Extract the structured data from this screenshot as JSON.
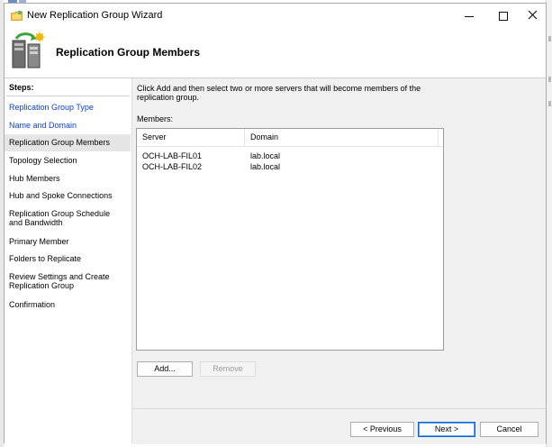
{
  "window": {
    "title": "New Replication Group Wizard",
    "header_title": "Replication Group Members"
  },
  "steps": {
    "title": "Steps:",
    "items": [
      {
        "label": "Replication Group Type",
        "state": "link"
      },
      {
        "label": "Name and Domain",
        "state": "link"
      },
      {
        "label": "Replication Group Members",
        "state": "current"
      },
      {
        "label": "Topology Selection",
        "state": "pending"
      },
      {
        "label": "Hub Members",
        "state": "pending"
      },
      {
        "label": "Hub and Spoke Connections",
        "state": "pending"
      },
      {
        "label": "Replication Group Schedule and Bandwidth",
        "state": "pending"
      },
      {
        "label": "Primary Member",
        "state": "pending"
      },
      {
        "label": "Folders to Replicate",
        "state": "pending"
      },
      {
        "label": "Review Settings and Create Replication Group",
        "state": "pending"
      },
      {
        "label": "Confirmation",
        "state": "pending"
      }
    ]
  },
  "content": {
    "instruction": "Click Add and then select two or more servers that will become members of the replication group.",
    "members_label": "Members:",
    "columns": [
      "Server",
      "Domain"
    ],
    "rows": [
      [
        "OCH-LAB-FIL01",
        "lab.local"
      ],
      [
        "OCH-LAB-FIL02",
        "lab.local"
      ]
    ],
    "add_label": "Add...",
    "remove_label": "Remove"
  },
  "footer": {
    "previous_label": "< Previous",
    "next_label": "Next >",
    "cancel_label": "Cancel"
  },
  "colors": {
    "link": "#0b3fc9",
    "current_step_bg": "#e5e5e5",
    "content_bg": "#f0f0f0",
    "default_button_border": "#0a64d6"
  },
  "icons": {
    "title": "replication-wizard-icon",
    "header": "replication-servers-icon",
    "minimize": "minimize-icon",
    "maximize": "maximize-icon",
    "close": "close-icon"
  }
}
